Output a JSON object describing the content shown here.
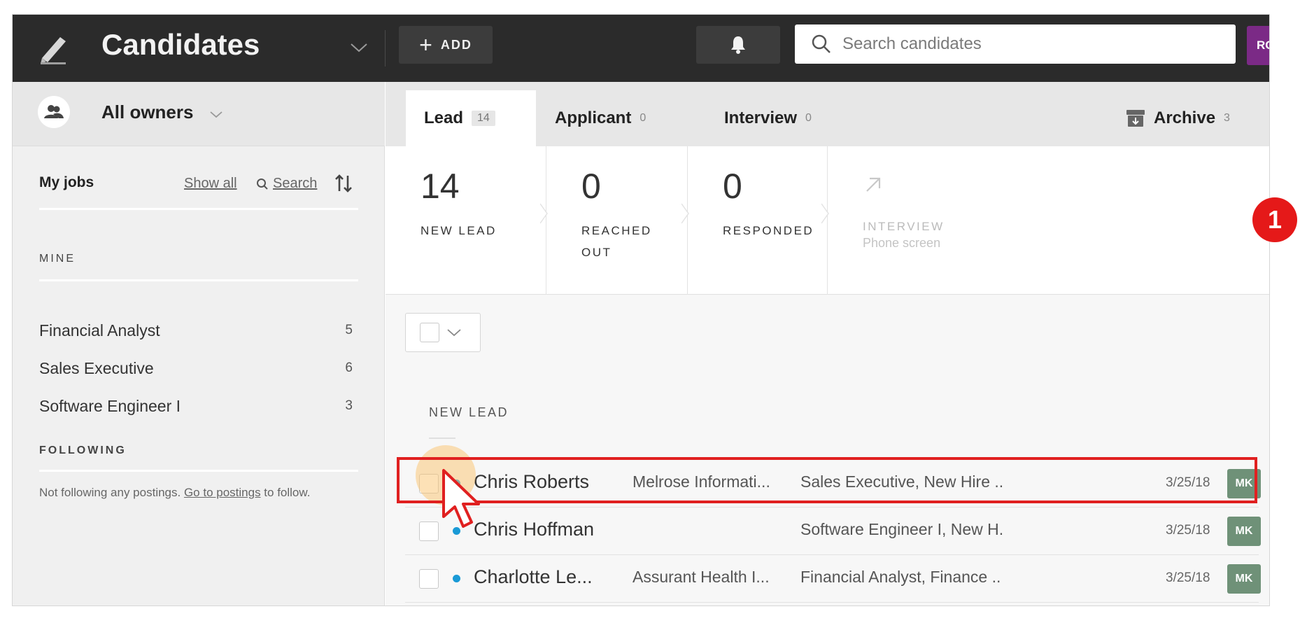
{
  "header": {
    "app_title": "Candidates",
    "add_label": "ADD",
    "search_placeholder": "Search candidates",
    "user_initials": "RC"
  },
  "sidebar": {
    "owner_filter": "All owners",
    "my_jobs_label": "My jobs",
    "show_all": "Show all",
    "search": "Search",
    "mine_label": "MINE",
    "jobs": [
      {
        "name": "Financial Analyst",
        "count": "5"
      },
      {
        "name": "Sales Executive",
        "count": "6"
      },
      {
        "name": "Software Engineer I",
        "count": "3"
      }
    ],
    "following_label": "FOLLOWING",
    "following_note_pre": "Not following any postings. ",
    "following_link": "Go to postings",
    "following_note_post": " to follow."
  },
  "tabs": [
    {
      "label": "Lead",
      "count": "14"
    },
    {
      "label": "Applicant",
      "count": "0"
    },
    {
      "label": "Interview",
      "count": "0"
    },
    {
      "label": "Archive",
      "count": "3"
    }
  ],
  "stages": [
    {
      "count": "14",
      "label": "NEW LEAD",
      "sub": ""
    },
    {
      "count": "0",
      "label": "REACHED OUT",
      "sub": ""
    },
    {
      "count": "0",
      "label": "RESPONDED",
      "sub": ""
    },
    {
      "count": "",
      "label": "INTERVIEW",
      "sub": "Phone screen"
    }
  ],
  "section_label": "NEW LEAD",
  "candidates": [
    {
      "name": "Chris Roberts",
      "company": "Melrose Informati...",
      "role": "Sales Executive, New Hire ..",
      "date": "3/25/18",
      "owner": "MK"
    },
    {
      "name": "Chris Hoffman",
      "company": "",
      "role": "Software Engineer I, New H.",
      "date": "3/25/18",
      "owner": "MK"
    },
    {
      "name": "Charlotte Le...",
      "company": "Assurant Health I...",
      "role": "Financial Analyst, Finance ..",
      "date": "3/25/18",
      "owner": "MK"
    }
  ],
  "step_badge": "1",
  "colors": {
    "topbar": "#2b2b2b",
    "highlight": "#e02020",
    "badge": "#e51919",
    "unread_dot": "#1a9ad6",
    "owner_chip": "#6f9178"
  }
}
